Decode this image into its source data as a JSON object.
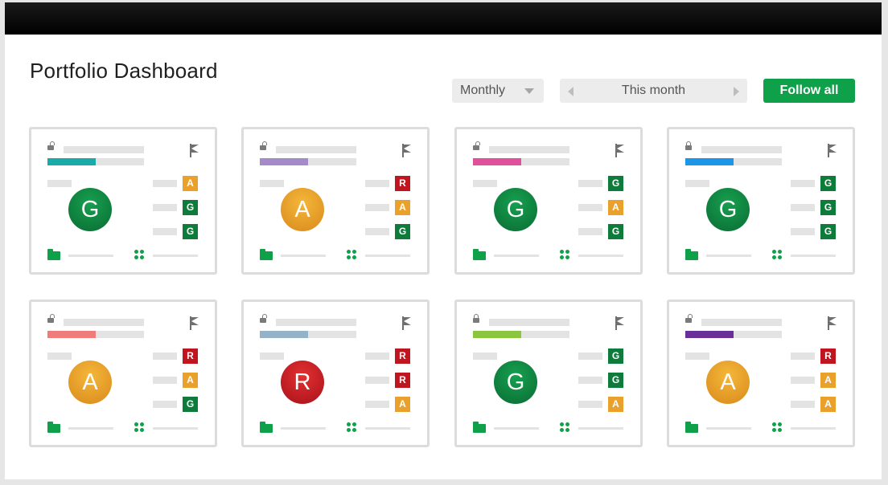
{
  "header": {
    "title": "Portfolio Dashboard",
    "period_select": "Monthly",
    "range_label": "This month",
    "follow_label": "Follow all"
  },
  "colors": {
    "green": "#0d7b3a",
    "amber": "#e9a12c",
    "red": "#c0141f",
    "accent_button": "#0fa14a"
  },
  "icons": {
    "lock": "lock-icon",
    "flag": "flag-icon",
    "folder": "folder-icon",
    "dots": "grid-dots-icon",
    "chevron_down": "chevron-down-icon",
    "chevron_left": "chevron-left-icon",
    "chevron_right": "chevron-right-icon"
  },
  "cards": [
    {
      "lock": "open",
      "accent": "#1aaaa8",
      "status": "G",
      "indicators": [
        "A",
        "G",
        "G"
      ]
    },
    {
      "lock": "open",
      "accent": "#a48bc8",
      "status": "A",
      "indicators": [
        "R",
        "A",
        "G"
      ]
    },
    {
      "lock": "open",
      "accent": "#e0509c",
      "status": "G",
      "indicators": [
        "G",
        "A",
        "G"
      ]
    },
    {
      "lock": "closed",
      "accent": "#1e96e8",
      "status": "G",
      "indicators": [
        "G",
        "G",
        "G"
      ]
    },
    {
      "lock": "open",
      "accent": "#ef7b7b",
      "status": "A",
      "indicators": [
        "R",
        "A",
        "G"
      ]
    },
    {
      "lock": "open",
      "accent": "#94b3c9",
      "status": "R",
      "indicators": [
        "R",
        "R",
        "A"
      ]
    },
    {
      "lock": "closed",
      "accent": "#8cc63f",
      "status": "G",
      "indicators": [
        "G",
        "G",
        "A"
      ]
    },
    {
      "lock": "open",
      "accent": "#6a2e98",
      "status": "A",
      "indicators": [
        "R",
        "A",
        "A"
      ]
    }
  ]
}
